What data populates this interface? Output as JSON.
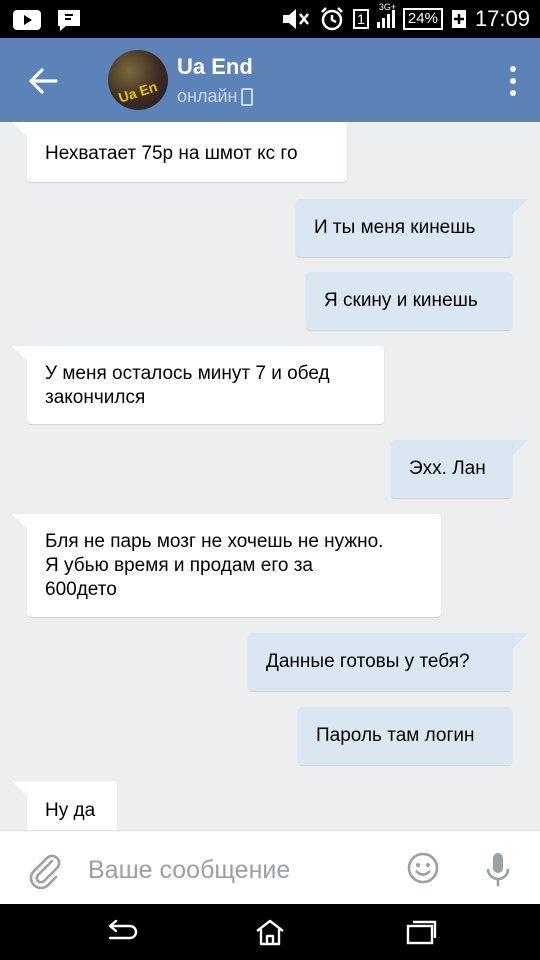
{
  "status_bar": {
    "network_label": "3G+",
    "sim_label": "1",
    "battery": "24%",
    "time": "17:09"
  },
  "header": {
    "contact_name": "Ua End",
    "status": "онлайн",
    "avatar_text": "Ua En"
  },
  "messages": [
    {
      "direction": "in",
      "text": "Нехватает 75р на шмот кс го"
    },
    {
      "direction": "out",
      "text": "И ты меня кинешь"
    },
    {
      "direction": "out",
      "text": "Я скину и кинешь"
    },
    {
      "direction": "in",
      "lines": [
        "У меня осталось минут 7 и обед",
        "закончился"
      ]
    },
    {
      "direction": "out",
      "text": "Эхх. Лан"
    },
    {
      "direction": "in",
      "lines": [
        "Бля не парь мозг не хочешь не нужно.",
        "Я убью время и продам его за",
        "600дето"
      ]
    },
    {
      "direction": "out",
      "text": "Данные готовы у тебя?"
    },
    {
      "direction": "out",
      "text": "Пароль там логин"
    },
    {
      "direction": "in",
      "text": "Ну да"
    }
  ],
  "composer": {
    "placeholder": "Ваше сообщение"
  },
  "icons": {
    "back": "arrow-left-icon",
    "menu": "more-vertical-icon",
    "attach": "paperclip-icon",
    "emoji": "smiley-icon",
    "mic": "microphone-icon",
    "nav_back": "android-back-icon",
    "nav_home": "android-home-icon",
    "nav_recents": "android-recents-icon"
  },
  "colors": {
    "header": "#5b83b8",
    "chat_bg": "#edeef0",
    "incoming_bubble": "#ffffff",
    "outgoing_bubble": "#dbe6f3"
  }
}
